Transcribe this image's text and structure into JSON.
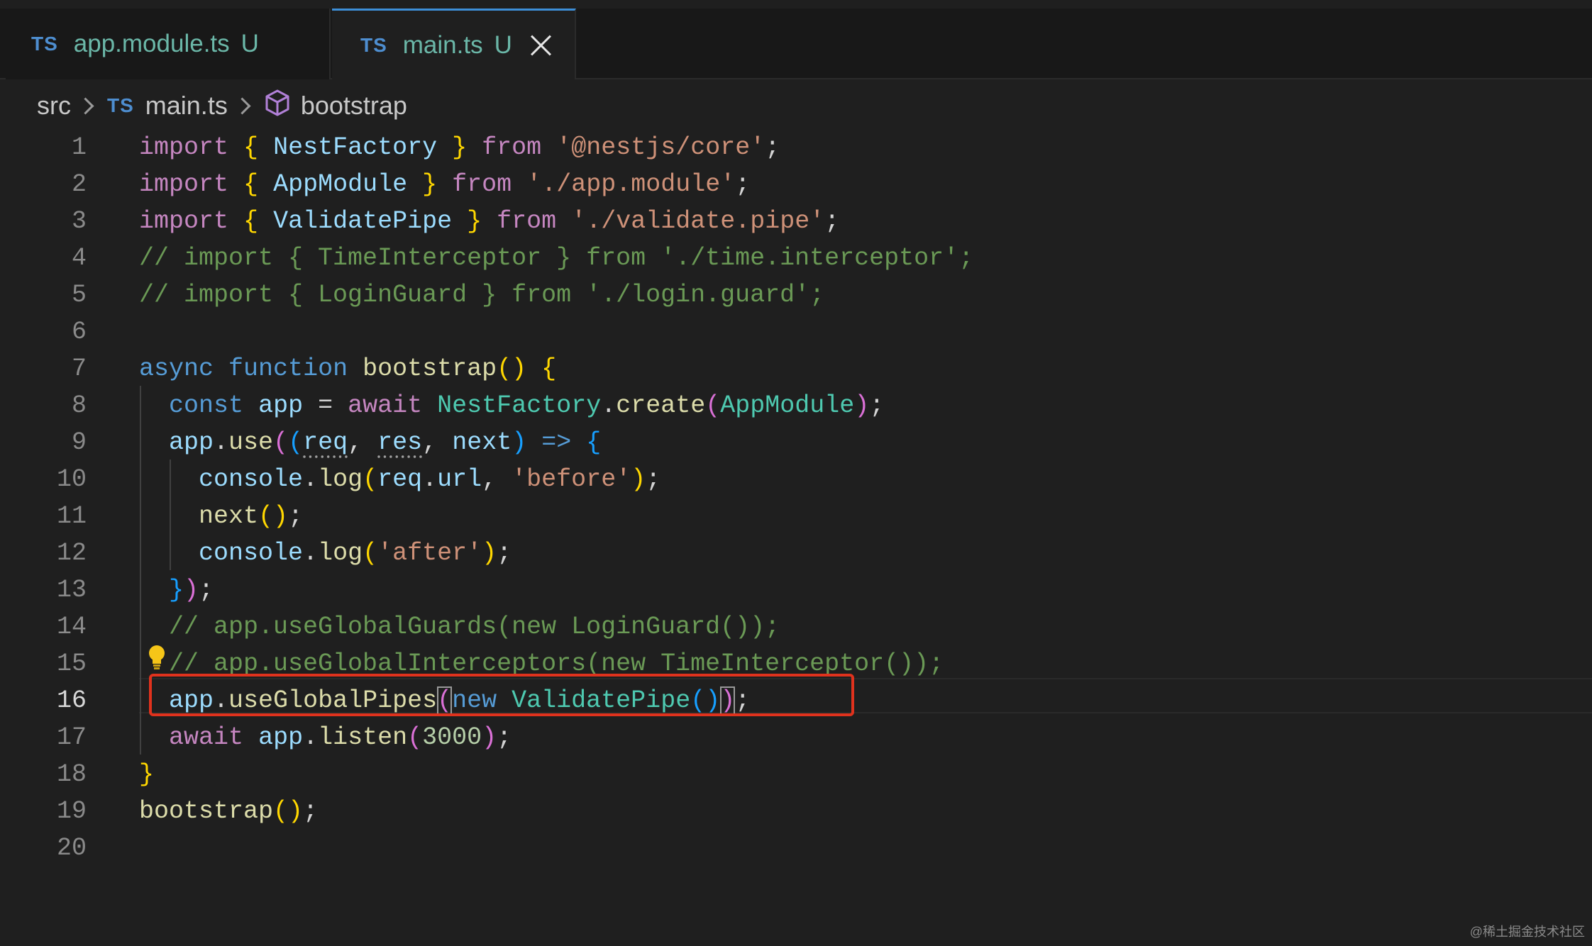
{
  "tabs": [
    {
      "icon": "TS",
      "label": "app.module.ts",
      "status": "U"
    },
    {
      "icon": "TS",
      "label": "main.ts",
      "status": "U"
    }
  ],
  "breadcrumb": {
    "folder": "src",
    "file_icon": "TS",
    "file": "main.ts",
    "symbol": "bootstrap"
  },
  "line_numbers": [
    "1",
    "2",
    "3",
    "4",
    "5",
    "6",
    "7",
    "8",
    "9",
    "10",
    "11",
    "12",
    "13",
    "14",
    "15",
    "16",
    "17",
    "18",
    "19",
    "20"
  ],
  "active_line": "16",
  "code": {
    "l1": [
      "import",
      "{",
      "NestFactory",
      "}",
      "from",
      "'@nestjs/core'",
      ";"
    ],
    "l2": [
      "import",
      "{",
      "AppModule",
      "}",
      "from",
      "'./app.module'",
      ";"
    ],
    "l3": [
      "import",
      "{",
      "ValidatePipe",
      "}",
      "from",
      "'./validate.pipe'",
      ";"
    ],
    "l4": "// import { TimeInterceptor } from './time.interceptor';",
    "l5": "// import { LoginGuard } from './login.guard';",
    "l7": [
      "async",
      "function",
      "bootstrap",
      "(",
      ")",
      "{"
    ],
    "l8": [
      "const",
      "app",
      "=",
      "await",
      "NestFactory",
      ".",
      "create",
      "(",
      "AppModule",
      ")",
      ";"
    ],
    "l9": [
      "app",
      ".",
      "use",
      "(",
      "(",
      "req",
      ",",
      "res",
      ",",
      "next",
      ")",
      "=>",
      "{"
    ],
    "l10": [
      "console",
      ".",
      "log",
      "(",
      "req",
      ".",
      "url",
      ",",
      "'before'",
      ")",
      ";"
    ],
    "l11": [
      "next",
      "()",
      ";"
    ],
    "l12": [
      "console",
      ".",
      "log",
      "(",
      "'after'",
      ")",
      ";"
    ],
    "l13": [
      "}",
      ")",
      ";"
    ],
    "l14": "// app.useGlobalGuards(new LoginGuard());",
    "l15": "// app.useGlobalInterceptors(new TimeInterceptor());",
    "l16": [
      "app",
      ".",
      "useGlobalPipes",
      "(",
      "new",
      "ValidatePipe",
      "()",
      ")",
      ";"
    ],
    "l17": [
      "await",
      "app",
      ".",
      "listen",
      "(",
      "3000",
      ")",
      ";"
    ],
    "l18": [
      "}"
    ],
    "l19": [
      "bootstrap",
      "()",
      ";"
    ]
  },
  "watermark": "@稀土掘金技术社区",
  "colors": {
    "background": "#1f1f1f",
    "highlight_box": "#e0321d",
    "ts_icon": "#4e8ed0",
    "untracked": "#6bb7a8"
  }
}
